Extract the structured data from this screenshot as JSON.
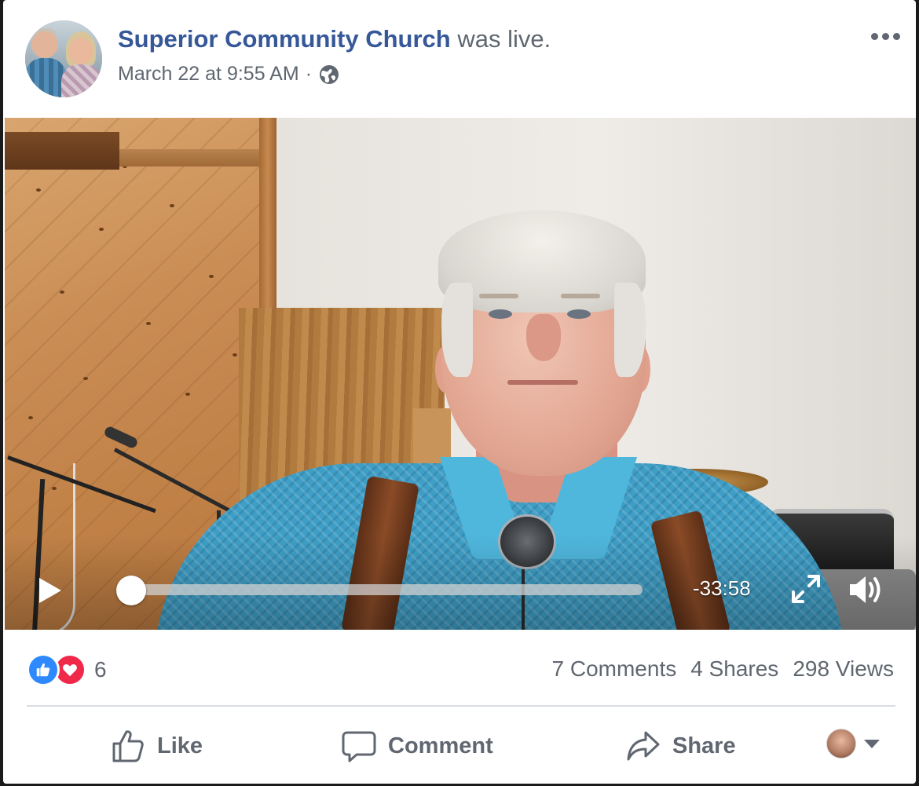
{
  "post": {
    "page_name": "Superior Community Church",
    "status_text": "was live.",
    "timestamp": "March 22 at 9:55 AM",
    "separator": "·",
    "audience_icon": "globe-icon"
  },
  "video": {
    "time_remaining": "-33:58",
    "progress": 0,
    "icons": {
      "play": "play-icon",
      "fullscreen": "fullscreen-icon",
      "volume": "volume-icon"
    }
  },
  "engagement": {
    "reaction_count": "6",
    "reaction_types": [
      "like",
      "love"
    ],
    "comments": "7 Comments",
    "shares": "4 Shares",
    "views": "298 Views"
  },
  "actions": {
    "like_label": "Like",
    "comment_label": "Comment",
    "share_label": "Share"
  },
  "colors": {
    "brand_link": "#365899",
    "secondary_text": "#606770",
    "like_blue": "#2e89ff",
    "love_red": "#f0284a"
  }
}
